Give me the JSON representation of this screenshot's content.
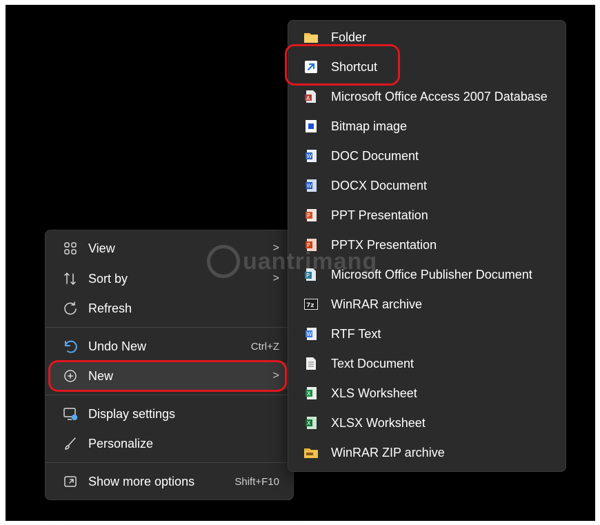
{
  "context_menu": {
    "items": [
      {
        "label": "View",
        "icon": "grid-view-icon",
        "submenu": true
      },
      {
        "label": "Sort by",
        "icon": "sort-icon",
        "submenu": true
      },
      {
        "label": "Refresh",
        "icon": "refresh-icon"
      },
      {
        "label": "Undo New",
        "icon": "undo-icon",
        "shortcut": "Ctrl+Z"
      },
      {
        "label": "New",
        "icon": "new-plus-icon",
        "submenu": true
      },
      {
        "label": "Display settings",
        "icon": "display-settings-icon"
      },
      {
        "label": "Personalize",
        "icon": "brush-icon"
      },
      {
        "label": "Show more options",
        "icon": "show-more-icon",
        "shortcut": "Shift+F10"
      }
    ],
    "submenu_arrow": ">"
  },
  "new_submenu": {
    "items": [
      {
        "label": "Folder",
        "icon": "folder-icon"
      },
      {
        "label": "Shortcut",
        "icon": "shortcut-icon"
      },
      {
        "label": "Microsoft Office Access 2007 Database",
        "icon": "access-db-icon"
      },
      {
        "label": "Bitmap image",
        "icon": "bitmap-icon"
      },
      {
        "label": "DOC Document",
        "icon": "doc-icon"
      },
      {
        "label": "DOCX Document",
        "icon": "docx-icon"
      },
      {
        "label": "PPT Presentation",
        "icon": "ppt-icon"
      },
      {
        "label": "PPTX Presentation",
        "icon": "pptx-icon"
      },
      {
        "label": "Microsoft Office Publisher Document",
        "icon": "publisher-icon"
      },
      {
        "label": "WinRAR archive",
        "icon": "winrar-icon"
      },
      {
        "label": "RTF Text",
        "icon": "rtf-icon"
      },
      {
        "label": "Text Document",
        "icon": "text-document-icon"
      },
      {
        "label": "XLS Worksheet",
        "icon": "xls-icon"
      },
      {
        "label": "XLSX Worksheet",
        "icon": "xlsx-icon"
      },
      {
        "label": "WinRAR ZIP archive",
        "icon": "winrar-zip-icon"
      }
    ]
  },
  "watermark": {
    "text": "uantrimang"
  },
  "colors": {
    "menu_bg": "#2b2b2b",
    "highlight": "#e0161d",
    "text": "#ffffff"
  }
}
